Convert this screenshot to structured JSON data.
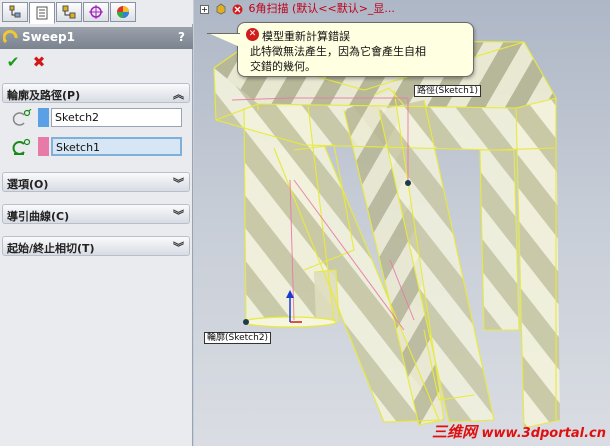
{
  "panel": {
    "title": "Sweep1",
    "help": "?",
    "ok_glyph": "✔",
    "cancel_glyph": "✖",
    "tabs": [
      "feature-manager-icon",
      "property-manager-icon",
      "configuration-manager-icon",
      "dimxpert-icon",
      "display-manager-icon"
    ]
  },
  "sections": {
    "profile_path": "輪廓及路徑(P)",
    "options": "選項(O)",
    "guide_curves": "導引曲線(C)",
    "start_end_tangency": "起始/終止相切(T)"
  },
  "selections": {
    "profile": {
      "value": "Sketch2",
      "color": "#5aa0e6"
    },
    "path": {
      "value": "Sketch1",
      "color": "#e87aa8"
    }
  },
  "tree": {
    "expand": "+",
    "root": "6角扫描 (默认<<默认>_显..."
  },
  "error": {
    "title": "模型重新計算錯誤",
    "line1": "此特徵無法產生，因為它會產生自相",
    "line2": "交錯的幾何。"
  },
  "callouts": {
    "path": "路徑(Sketch1)",
    "profile": "輪廓(Sketch2)"
  },
  "watermark": {
    "cn": "三维网",
    "url": "www.3dportal.cn"
  },
  "colors": {
    "model_edge": "#e8ea3a",
    "path_sketch": "#e87aa8",
    "error_red": "#c0001a"
  }
}
